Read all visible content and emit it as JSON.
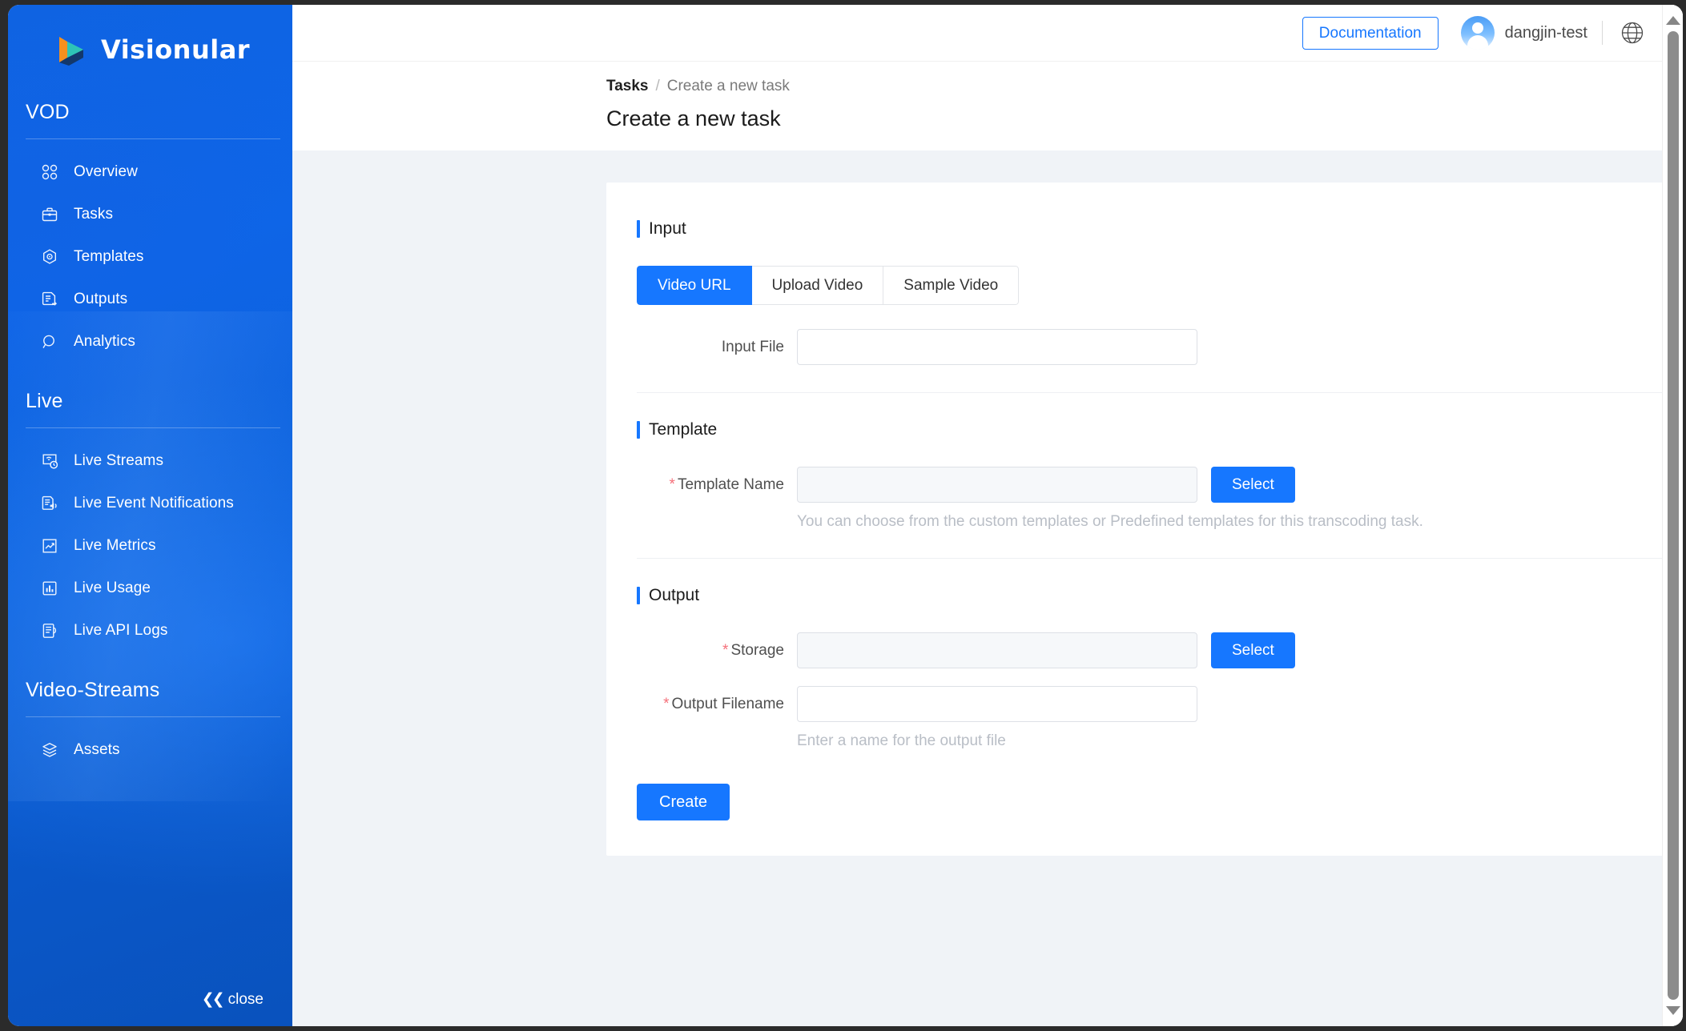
{
  "brand": {
    "name": "Visionular",
    "logo_icon": "play-logo-icon"
  },
  "sidebar": {
    "sections": [
      {
        "title": "VOD",
        "items": [
          {
            "label": "Overview",
            "icon": "grid-four-squares-icon"
          },
          {
            "label": "Tasks",
            "icon": "briefcase-icon"
          },
          {
            "label": "Templates",
            "icon": "hexagon-target-icon"
          },
          {
            "label": "Outputs",
            "icon": "document-arrow-icon"
          },
          {
            "label": "Analytics",
            "icon": "magnifier-icon"
          }
        ]
      },
      {
        "title": "Live",
        "items": [
          {
            "label": "Live Streams",
            "icon": "stream-clock-icon"
          },
          {
            "label": "Live Event Notifications",
            "icon": "document-speaker-icon"
          },
          {
            "label": "Live Metrics",
            "icon": "line-chart-icon"
          },
          {
            "label": "Live Usage",
            "icon": "bar-chart-icon"
          },
          {
            "label": "Live API Logs",
            "icon": "logs-list-icon"
          }
        ]
      },
      {
        "title": "Video-Streams",
        "items": [
          {
            "label": "Assets",
            "icon": "layers-icon"
          }
        ]
      }
    ],
    "collapse": {
      "label": "close",
      "icon": "double-chevron-left-icon"
    }
  },
  "topbar": {
    "documentation_label": "Documentation",
    "username": "dangjin-test",
    "globe_icon": "globe-icon",
    "avatar_icon": "user-avatar-icon"
  },
  "breadcrumb": {
    "root": "Tasks",
    "separator": "/",
    "current": "Create a new task"
  },
  "page": {
    "title": "Create a new task"
  },
  "form": {
    "input_section": {
      "heading": "Input",
      "tabs": [
        {
          "label": "Video URL",
          "active": true
        },
        {
          "label": "Upload Video",
          "active": false
        },
        {
          "label": "Sample Video",
          "active": false
        }
      ],
      "input_file": {
        "label": "Input File",
        "value": "",
        "placeholder": ""
      }
    },
    "template_section": {
      "heading": "Template",
      "template_name": {
        "label": "Template Name",
        "required_marker": "*",
        "value": "",
        "placeholder": "",
        "select_button": "Select"
      },
      "helper": "You can choose from the custom templates or Predefined templates for this transcoding task."
    },
    "output_section": {
      "heading": "Output",
      "storage": {
        "label": "Storage",
        "required_marker": "*",
        "value": "",
        "placeholder": "",
        "select_button": "Select"
      },
      "output_filename": {
        "label": "Output Filename",
        "required_marker": "*",
        "value": "",
        "placeholder": ""
      },
      "helper": "Enter a name for the output file"
    },
    "submit_label": "Create"
  },
  "colors": {
    "accent": "#1677ff",
    "sidebar_blue": "#0d66e8",
    "required_red": "#f5707a",
    "page_bg": "#f0f3f7",
    "logo_orange": "#f7901e",
    "logo_teal": "#1fb6a6",
    "logo_navy": "#13386b"
  }
}
